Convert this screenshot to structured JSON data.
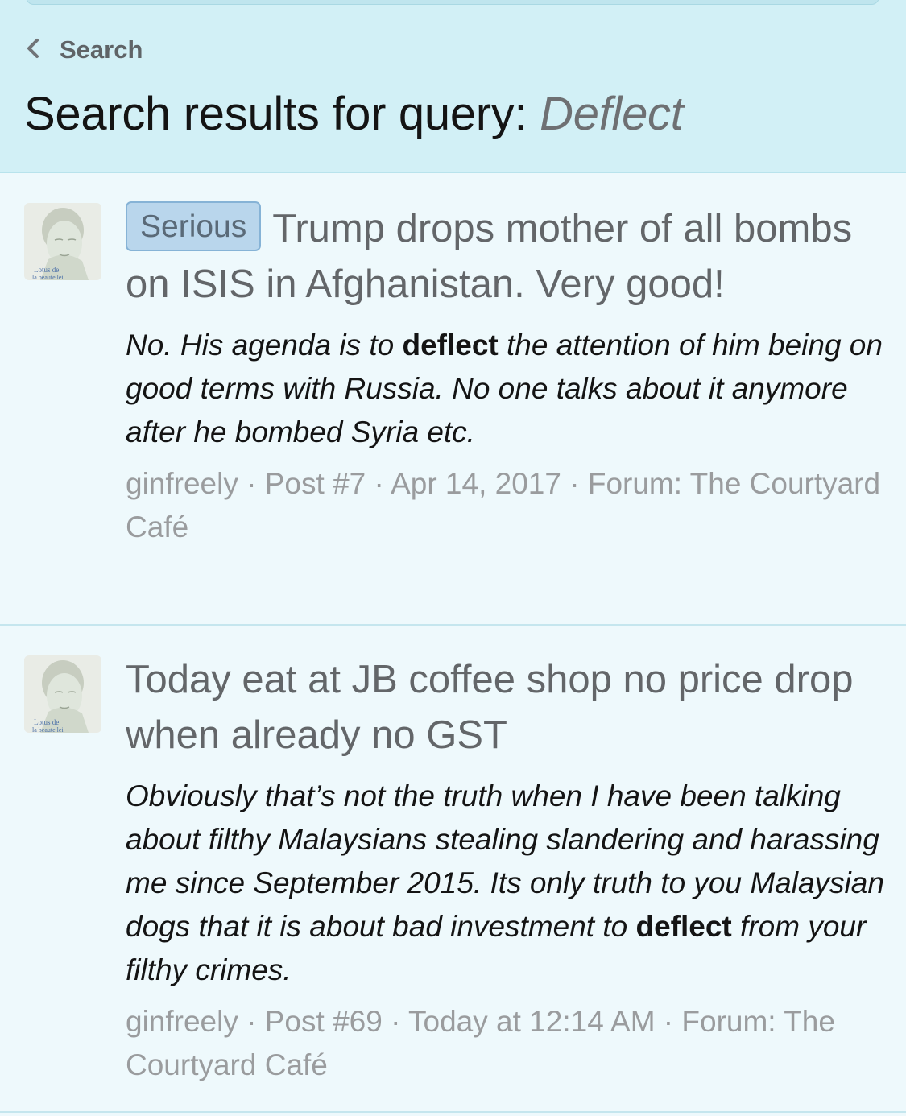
{
  "header": {
    "back_label": "Search",
    "title_prefix": "Search results for query: ",
    "query": "Deflect"
  },
  "results": [
    {
      "prefix": "Serious",
      "title": "Trump drops mother of all bombs on ISIS in Afghanistan. Very good!",
      "snippet_before": "No. His agenda is to ",
      "snippet_highlight": "deflect",
      "snippet_after": " the attention of him being on good terms with Russia. No one talks about it anymore after he bombed Syria etc.",
      "author": "ginfreely",
      "sep": " · ",
      "post": "Post #7",
      "date": "Apr 14, 2017",
      "forum": "Forum: The Courtyard Café",
      "avatar_text": "Lotus de la beaute lei"
    },
    {
      "prefix": "",
      "title": "Today eat at JB coffee shop no price drop when already no GST",
      "snippet_before": "Obviously that’s not the truth when I have been talking about filthy Malaysians stealing slandering and harassing me since September 2015. Its only truth to you Malaysian dogs that it is about bad investment to ",
      "snippet_highlight": "deflect",
      "snippet_after": " from your filthy crimes.",
      "author": "ginfreely",
      "sep": " · ",
      "post": "Post #69",
      "date": "Today at 12:14 AM",
      "forum": "Forum: The Courtyard Café",
      "avatar_text": "Lotus de la beaute lei"
    }
  ],
  "colors": {
    "header_bg": "#d2f0f6",
    "page_bg": "#eef9fc",
    "badge_bg": "#b9d6ec",
    "meta_text": "#9a9c9e"
  },
  "icons": {
    "back": "chevron-left-icon",
    "avatar": "buddha-statue-avatar"
  }
}
